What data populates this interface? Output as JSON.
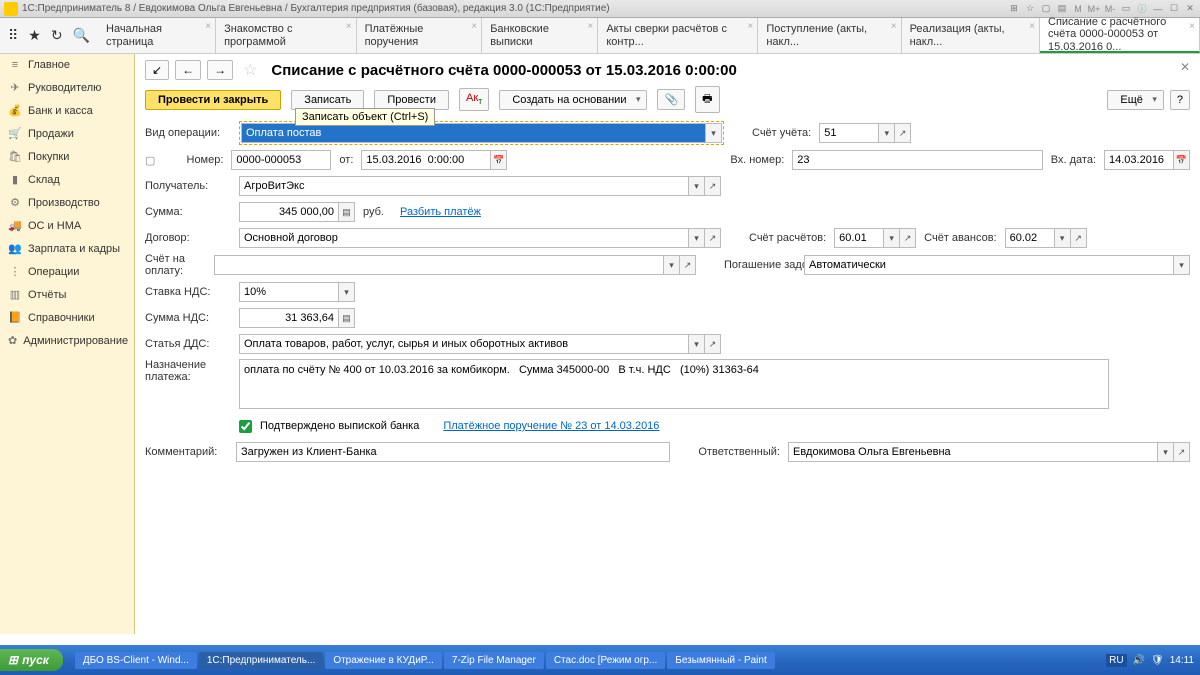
{
  "titlebar": "1С:Предприниматель 8 / Евдокимова Ольга Евгеньевна / Бухгалтерия предприятия (базовая), редакция 3.0  (1С:Предприятие)",
  "tabs": [
    "Начальная страница",
    "Знакомство с программой",
    "Платёжные поручения",
    "Банковские выписки",
    "Акты сверки расчётов с контр...",
    "Поступление (акты, накл...",
    "Реализация (акты, накл...",
    "Списание с расчётного счёта 0000-000053 от 15.03.2016 0..."
  ],
  "sidebar": [
    {
      "icon": "≡",
      "label": "Главное"
    },
    {
      "icon": "✈",
      "label": "Руководителю"
    },
    {
      "icon": "💰",
      "label": "Банк и касса"
    },
    {
      "icon": "🛒",
      "label": "Продажи"
    },
    {
      "icon": "🛍",
      "label": "Покупки"
    },
    {
      "icon": "▮",
      "label": "Склад"
    },
    {
      "icon": "⚙",
      "label": "Производство"
    },
    {
      "icon": "🚚",
      "label": "ОС и НМА"
    },
    {
      "icon": "👥",
      "label": "Зарплата и кадры"
    },
    {
      "icon": "⋮",
      "label": "Операции"
    },
    {
      "icon": "▥",
      "label": "Отчёты"
    },
    {
      "icon": "📙",
      "label": "Справочники"
    },
    {
      "icon": "✿",
      "label": "Администрирование"
    }
  ],
  "doc": {
    "title": "Списание с расчётного счёта 0000-000053 от 15.03.2016 0:00:00",
    "btn_save_close": "Провести и закрыть",
    "btn_record": "Записать",
    "btn_post": "Провести",
    "btn_create": "Создать на основании",
    "btn_more": "Ещё",
    "tooltip": "Записать объект (Ctrl+S)",
    "labels": {
      "vid": "Вид операции:",
      "nomer": "Номер:",
      "ot": "от:",
      "poluch": "Получатель:",
      "summa": "Сумма:",
      "rub": "руб.",
      "razbit": "Разбить платёж",
      "dogovor": "Договор:",
      "schet_oplatu": "Счёт на оплату:",
      "stavka_nds": "Ставка НДС:",
      "summa_nds": "Сумма НДС:",
      "statya_dds": "Статья ДДС:",
      "naznach": "Назначение платежа:",
      "confirmed": "Подтверждено выпиской банка",
      "plat_link": "Платёжное поручение № 23 от 14.03.2016",
      "komment": "Комментарий:",
      "schet_ucheta": "Счёт учёта:",
      "vh_nomer": "Вх. номер:",
      "vh_data": "Вх. дата:",
      "schet_rasch": "Счёт расчётов:",
      "schet_avans": "Счёт авансов:",
      "pogash": "Погашение задолженности:",
      "otvetstv": "Ответственный:"
    },
    "values": {
      "vid": "Оплата постав",
      "nomer": "0000-000053",
      "date": "15.03.2016  0:00:00",
      "poluch": "АгроВитЭкс",
      "summa": "345 000,00",
      "dogovor": "Основной договор",
      "stavka_nds": "10%",
      "summa_nds": "31 363,64",
      "statya_dds": "Оплата товаров, работ, услуг, сырья и иных оборотных активов",
      "naznach": "оплата по счёту № 400 от 10.03.2016 за комбикорм.   Сумма 345000-00   В т.ч. НДС   (10%) 31363-64",
      "komment": "Загружен из Клиент-Банка",
      "schet_ucheta": "51",
      "vh_nomer": "23",
      "vh_data": "14.03.2016",
      "schet_rasch": "60.01",
      "schet_avans": "60.02",
      "pogash": "Автоматически",
      "otvetstv": "Евдокимова Ольга Евгеньевна"
    }
  },
  "taskbar": {
    "start": "пуск",
    "items": [
      "ДБО BS-Client - Wind...",
      "1С:Предприниматель...",
      "Отражение в КУДиР...",
      "7-Zip File Manager",
      "Стас.doc [Режим огр...",
      "Безымянный - Paint"
    ],
    "lang": "RU",
    "time": "14:11"
  }
}
